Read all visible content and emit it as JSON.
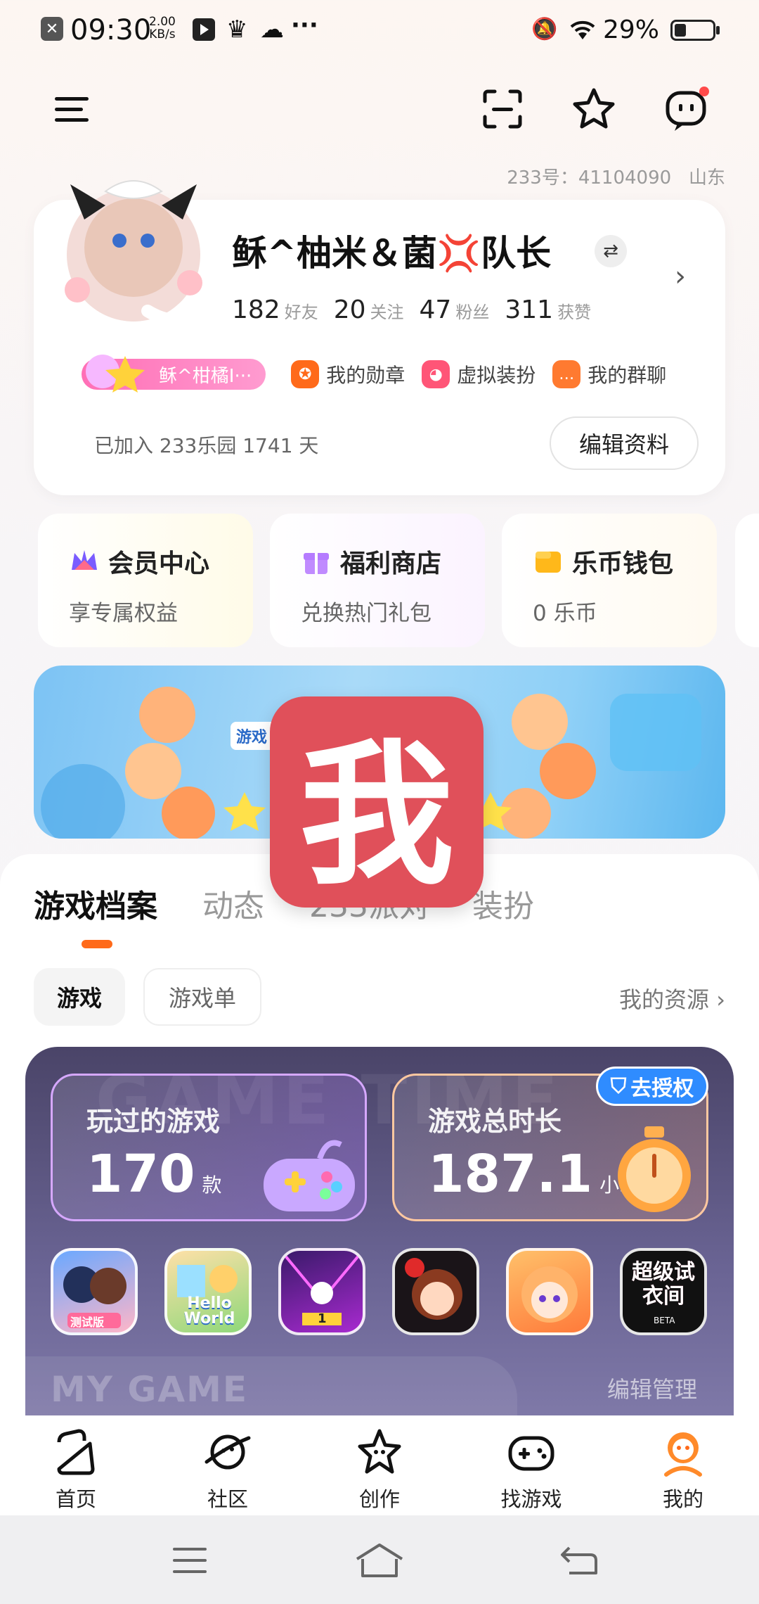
{
  "status_bar": {
    "time": "09:30",
    "speed_value": "2.00",
    "speed_unit": "KB/s",
    "more": "···",
    "battery": "29%"
  },
  "profile": {
    "uid": "233号：41104090",
    "region": "山东",
    "nickname": "稣^柚米＆菌💢队长",
    "stats": [
      {
        "num": "182",
        "label": "好友"
      },
      {
        "num": "20",
        "label": "关注"
      },
      {
        "num": "47",
        "label": "粉丝"
      },
      {
        "num": "311",
        "label": "获赞"
      }
    ],
    "name_tag": "稣^柑橘I···",
    "chips": [
      {
        "label": "我的勋章",
        "icon": "medal-icon",
        "color": "#ff6a1a"
      },
      {
        "label": "虚拟装扮",
        "icon": "cat-icon",
        "color": "#ff5577"
      },
      {
        "label": "我的群聊",
        "icon": "group-chat-icon",
        "color": "#ff7a30"
      }
    ],
    "joined": "已加入 233乐园 1741 天",
    "edit_button": "编辑资料"
  },
  "features": [
    {
      "title": "会员中心",
      "subtitle": "享专属权益",
      "icon": "vip-crown-icon",
      "color": "#7a5cff"
    },
    {
      "title": "福利商店",
      "subtitle": "兑换热门礼包",
      "icon": "gift-icon",
      "color": "#b57bff"
    },
    {
      "title": "乐币钱包",
      "subtitle": "0 乐币",
      "icon": "wallet-icon",
      "color": "#ffb81a"
    }
  ],
  "banner": {
    "tag": "游戏"
  },
  "overlay_char": "我",
  "tabs": [
    "游戏档案",
    "动态",
    "233派对",
    "装扮"
  ],
  "pills": {
    "game": "游戏",
    "game_list": "游戏单"
  },
  "my_resources": "我的资源",
  "game_panel": {
    "watermark_top": "GAME TIME",
    "played_label": "玩过的游戏",
    "played_num": "170",
    "played_unit": "款",
    "time_label": "游戏总时长",
    "time_num": "187.1",
    "time_unit": "小时",
    "auth_label": "去授权",
    "watermark_bottom": "MY GAME",
    "edit_manage": "编辑管理",
    "games": [
      {
        "name": "game-icon-sakura",
        "badge": "测试版"
      },
      {
        "name": "game-icon-hello-world",
        "badge": "Hello World"
      },
      {
        "name": "game-icon-dance",
        "badge": "1"
      },
      {
        "name": "game-icon-chibi",
        "badge": ""
      },
      {
        "name": "game-icon-anime-girl",
        "badge": ""
      },
      {
        "name": "game-icon-dressup",
        "badge": "超级试衣间"
      }
    ],
    "dressup_badge2": "BETA"
  },
  "nav": [
    {
      "label": "首页",
      "icon": "home-icon"
    },
    {
      "label": "社区",
      "icon": "planet-icon"
    },
    {
      "label": "创作",
      "icon": "star-create-icon"
    },
    {
      "label": "找游戏",
      "icon": "gamepad-icon"
    },
    {
      "label": "我的",
      "icon": "profile-icon",
      "active": true
    }
  ],
  "colors": {
    "accent": "#ff6a1a",
    "overlay": "#e0505a",
    "panel": "#5a5480"
  }
}
